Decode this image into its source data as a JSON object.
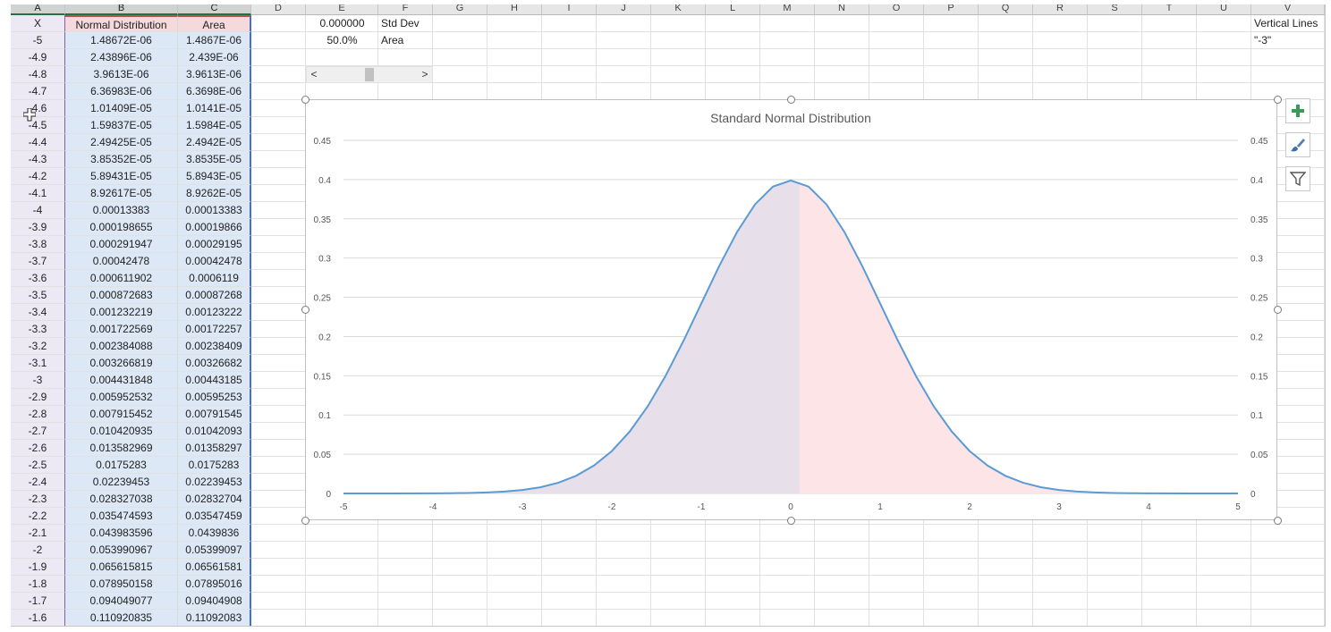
{
  "columns": [
    "A",
    "B",
    "C",
    "D",
    "E",
    "F",
    "G",
    "H",
    "I",
    "J",
    "K",
    "L",
    "M",
    "N",
    "O",
    "P",
    "Q",
    "R",
    "S",
    "T",
    "U",
    "V"
  ],
  "table": {
    "headers": [
      "X",
      "Normal Distribution",
      "Area"
    ],
    "rows": [
      [
        "-5",
        "1.48672E-06",
        "1.4867E-06"
      ],
      [
        "-4.9",
        "2.43896E-06",
        "2.439E-06"
      ],
      [
        "-4.8",
        "3.9613E-06",
        "3.9613E-06"
      ],
      [
        "-4.7",
        "6.36983E-06",
        "6.3698E-06"
      ],
      [
        "-4.6",
        "1.01409E-05",
        "1.0141E-05"
      ],
      [
        "-4.5",
        "1.59837E-05",
        "1.5984E-05"
      ],
      [
        "-4.4",
        "2.49425E-05",
        "2.4942E-05"
      ],
      [
        "-4.3",
        "3.85352E-05",
        "3.8535E-05"
      ],
      [
        "-4.2",
        "5.89431E-05",
        "5.8943E-05"
      ],
      [
        "-4.1",
        "8.92617E-05",
        "8.9262E-05"
      ],
      [
        "-4",
        "0.00013383",
        "0.00013383"
      ],
      [
        "-3.9",
        "0.000198655",
        "0.00019866"
      ],
      [
        "-3.8",
        "0.000291947",
        "0.00029195"
      ],
      [
        "-3.7",
        "0.00042478",
        "0.00042478"
      ],
      [
        "-3.6",
        "0.000611902",
        "0.0006119"
      ],
      [
        "-3.5",
        "0.000872683",
        "0.00087268"
      ],
      [
        "-3.4",
        "0.001232219",
        "0.00123222"
      ],
      [
        "-3.3",
        "0.001722569",
        "0.00172257"
      ],
      [
        "-3.2",
        "0.002384088",
        "0.00238409"
      ],
      [
        "-3.1",
        "0.003266819",
        "0.00326682"
      ],
      [
        "-3",
        "0.004431848",
        "0.00443185"
      ],
      [
        "-2.9",
        "0.005952532",
        "0.00595253"
      ],
      [
        "-2.8",
        "0.007915452",
        "0.00791545"
      ],
      [
        "-2.7",
        "0.010420935",
        "0.01042093"
      ],
      [
        "-2.6",
        "0.013582969",
        "0.01358297"
      ],
      [
        "-2.5",
        "0.0175283",
        "0.0175283"
      ],
      [
        "-2.4",
        "0.02239453",
        "0.02239453"
      ],
      [
        "-2.3",
        "0.028327038",
        "0.02832704"
      ],
      [
        "-2.2",
        "0.035474593",
        "0.03547459"
      ],
      [
        "-2.1",
        "0.043983596",
        "0.0439836"
      ],
      [
        "-2",
        "0.053990967",
        "0.05399097"
      ],
      [
        "-1.9",
        "0.065615815",
        "0.06561581"
      ],
      [
        "-1.8",
        "0.078950158",
        "0.07895016"
      ],
      [
        "-1.7",
        "0.094049077",
        "0.09404908"
      ],
      [
        "-1.6",
        "0.110920835",
        "0.11092083"
      ]
    ]
  },
  "side": {
    "std_dev_value": "0.000000",
    "std_dev_label": "Std Dev",
    "area_value": "50.0%",
    "area_label": "Area",
    "vertical_lines_label": "Vertical Lines",
    "vertical_lines_value": "\"-3\"",
    "scroll_left": "<",
    "scroll_right": ">"
  },
  "colors": {
    "curve": "#5b9bd5",
    "left_fill": "#e7dfe9",
    "right_fill": "#fde4e6",
    "accent_green": "#217346",
    "plus_green": "#3a9a5a"
  },
  "chart_buttons": [
    "plus-icon",
    "brush-icon",
    "filter-icon"
  ],
  "chart_data": {
    "type": "area",
    "title": "Standard Normal Distribution",
    "xlabel": "",
    "ylabel": "",
    "xlim": [
      -5,
      5
    ],
    "ylim": [
      0,
      0.45
    ],
    "x_ticks": [
      "-5",
      "-4",
      "-3",
      "-2",
      "-1",
      "0",
      "1",
      "2",
      "3",
      "4",
      "5"
    ],
    "y_ticks": [
      "0",
      "0.05",
      "0.1",
      "0.15",
      "0.2",
      "0.25",
      "0.3",
      "0.35",
      "0.4",
      "0.45"
    ],
    "grid": true,
    "legend": "none",
    "series": [
      {
        "x": [
          -5,
          -4.5,
          -4,
          -3.8,
          -3.6,
          -3.4,
          -3.2,
          -3,
          -2.8,
          -2.6,
          -2.4,
          -2.2,
          -2,
          -1.8,
          -1.6,
          -1.4,
          -1.2,
          -1,
          -0.8,
          -0.6,
          -0.4,
          -0.2,
          0,
          0.2,
          0.4,
          0.6,
          0.8,
          1,
          1.2,
          1.4,
          1.6,
          1.8,
          2,
          2.2,
          2.4,
          2.6,
          2.8,
          3,
          3.2,
          3.4,
          3.6,
          3.8,
          4,
          4.5,
          5
        ],
        "y": [
          1.5e-06,
          1.6e-05,
          0.00013,
          0.00029,
          0.00061,
          0.0012,
          0.0024,
          0.0044,
          0.0079,
          0.0136,
          0.0224,
          0.0355,
          0.054,
          0.079,
          0.1109,
          0.1497,
          0.1942,
          0.242,
          0.2897,
          0.3332,
          0.3683,
          0.391,
          0.3989,
          0.391,
          0.3683,
          0.3332,
          0.2897,
          0.242,
          0.1942,
          0.1497,
          0.1109,
          0.079,
          0.054,
          0.0355,
          0.0224,
          0.0136,
          0.0079,
          0.0044,
          0.0024,
          0.0012,
          0.00061,
          0.00029,
          0.00013,
          1.6e-05,
          1.5e-06
        ]
      }
    ],
    "shaded_left_to": 0.1
  }
}
